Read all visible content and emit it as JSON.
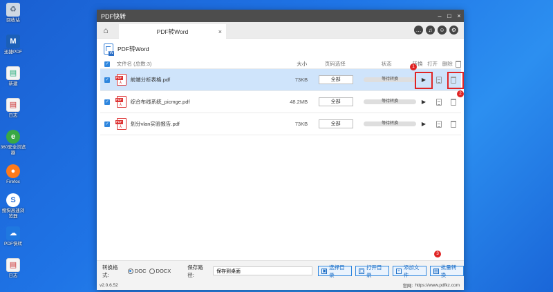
{
  "desktop": {
    "icons": [
      {
        "label": "回收站",
        "icon": "recycle-bin-icon",
        "color": "#cfd8e3"
      },
      {
        "label": "迅捷PDF",
        "icon": "app-icon",
        "color": "#1b5fb8"
      },
      {
        "label": "新建",
        "icon": "folder-icon",
        "color": "#f5c85a"
      },
      {
        "label": "日志",
        "icon": "document-icon",
        "color": "#e8e8e8"
      },
      {
        "label": "360安全浏览器",
        "icon": "browser-icon",
        "color": "#39a845"
      },
      {
        "label": "Firefox",
        "icon": "firefox-icon",
        "color": "#ff7a1a"
      },
      {
        "label": "搜狗高速浏览器",
        "icon": "sogou-icon",
        "color": "#2a6fd6"
      },
      {
        "label": "PDF快转",
        "icon": "pdf-app-icon",
        "color": "#1f78e0"
      },
      {
        "label": "日志",
        "icon": "document-icon",
        "color": "#e8e8e8"
      }
    ]
  },
  "window": {
    "title": "PDF快转",
    "controls": [
      "–",
      "□",
      "×"
    ]
  },
  "tabbar": {
    "tab_label": "PDF转Word",
    "tab_close": "×"
  },
  "section": {
    "title": "PDF转Word"
  },
  "table": {
    "headers": {
      "filename": "文件名 (总数:3)",
      "size": "大小",
      "range": "页码选择",
      "status": "状态",
      "convert": "转换",
      "open": "打开",
      "delete": "删除"
    },
    "rows": [
      {
        "name": "前端分析表格.pdf",
        "size": "73KB",
        "range": "全部",
        "status": "等待转换"
      },
      {
        "name": "综合布线系统_picmge.pdf",
        "size": "48.2MB",
        "range": "全部",
        "status": "等待转换"
      },
      {
        "name": "划分vlan实验报告.pdf",
        "size": "73KB",
        "range": "全部",
        "status": "等待转换"
      }
    ]
  },
  "annotations": {
    "badge1": "1",
    "badge2": "2",
    "badge3": "3",
    "accent": "#e02424"
  },
  "bottom": {
    "format_label": "转换格式:",
    "format_doc": "DOC",
    "format_docx": "DOCX",
    "path_label": "保存路径:",
    "path_value": "保存到桌面",
    "btn_choose": "选择目录",
    "btn_open": "打开目录",
    "btn_add": "添加文件",
    "btn_batch": "批量转换",
    "version": "v2.0.6.52",
    "site_label": "官网:",
    "site_url": "https://www.pdfkz.com"
  },
  "colors": {
    "accent": "#2e86de",
    "selected_row": "#cfe4fb",
    "titlebar": "#4d4d4d"
  }
}
